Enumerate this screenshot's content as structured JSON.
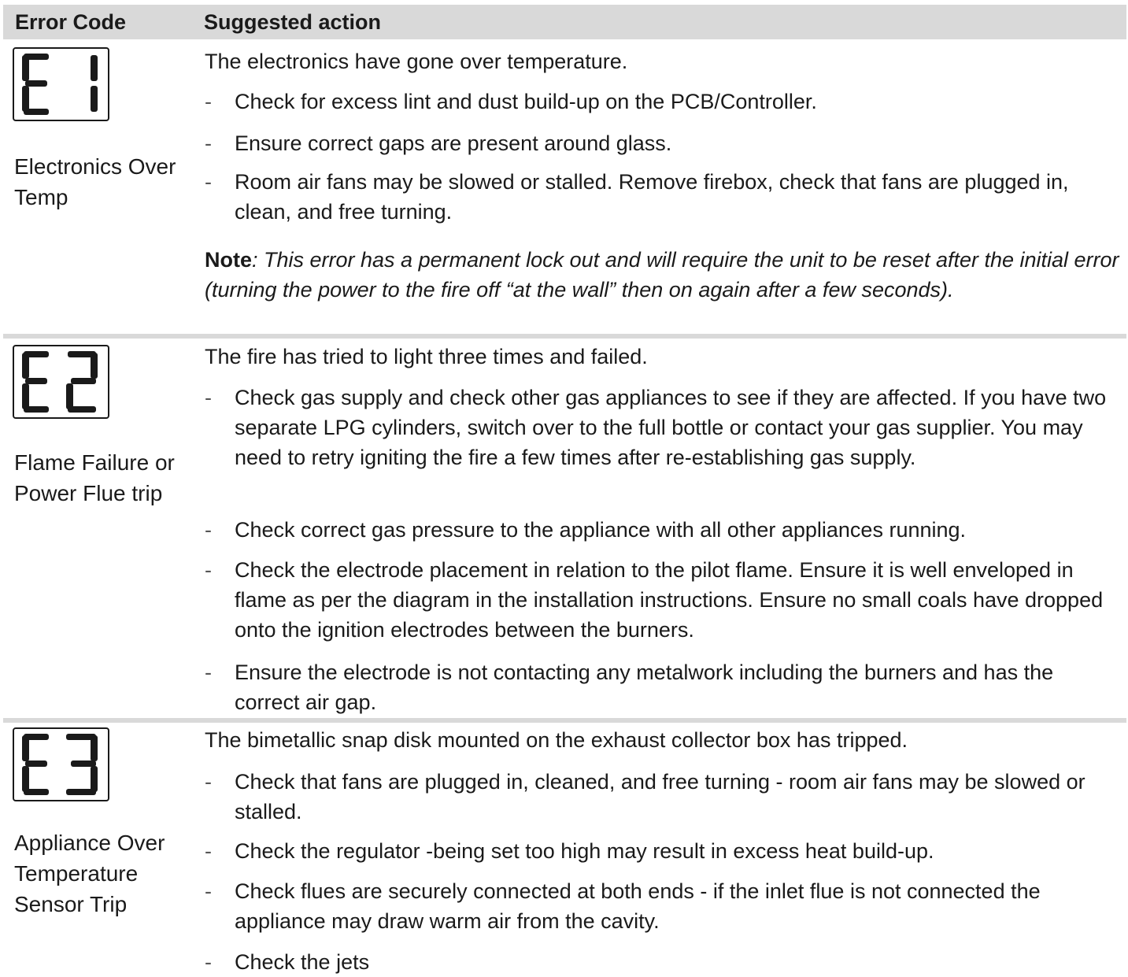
{
  "header": {
    "code_col": "Error Code",
    "action_col": "Suggested action"
  },
  "rows": [
    {
      "code": "E1",
      "label_lines": [
        "Electronics Over",
        "Temp"
      ],
      "lead": "The electronics have gone over temperature.",
      "items": [
        "Check for excess lint and dust build-up on the PCB/Controller.",
        "Ensure correct gaps are present around glass.",
        "Room air fans may be slowed or stalled. Remove firebox, check that fans are plugged in, clean, and free turning."
      ],
      "note_bold": "Note",
      "note_text": ": This error has a permanent lock out and will require the unit to be reset after the initial error (turning the power to the fire off “at the wall” then on again after a few seconds)."
    },
    {
      "code": "E2",
      "label_lines": [
        "Flame Failure or",
        "Power Flue trip"
      ],
      "lead": "The fire has tried to light three times and failed.",
      "items": [
        "Check gas supply and check other gas appliances to see if they are affected. If you have two separate LPG cylinders, switch over to the full bottle or contact your gas supplier. You may need to retry igniting the fire a few times after re-establishing gas supply.",
        "Check correct gas pressure to the appliance with all other appliances running.",
        "Check the electrode placement in relation to the pilot flame. Ensure it is well enveloped in flame as per the diagram in the installation instructions. Ensure no small coals have dropped onto the ignition electrodes between the burners.",
        "Ensure the electrode is not contacting any metalwork including the burners and has the correct air gap."
      ]
    },
    {
      "code": "E3",
      "label_lines": [
        "Appliance Over",
        "Temperature",
        "Sensor Trip"
      ],
      "lead": "The bimetallic snap disk mounted on the exhaust collector box has tripped.",
      "items": [
        "Check that fans are plugged in, cleaned, and free turning - room air fans may be slowed or stalled.",
        "Check the regulator -being set too high may result in excess heat build-up.",
        "Check flues are securely connected at both ends - if the inlet flue is not connected the appliance may draw warm air from the cavity.",
        "Check the jets"
      ]
    }
  ],
  "dash": "-"
}
